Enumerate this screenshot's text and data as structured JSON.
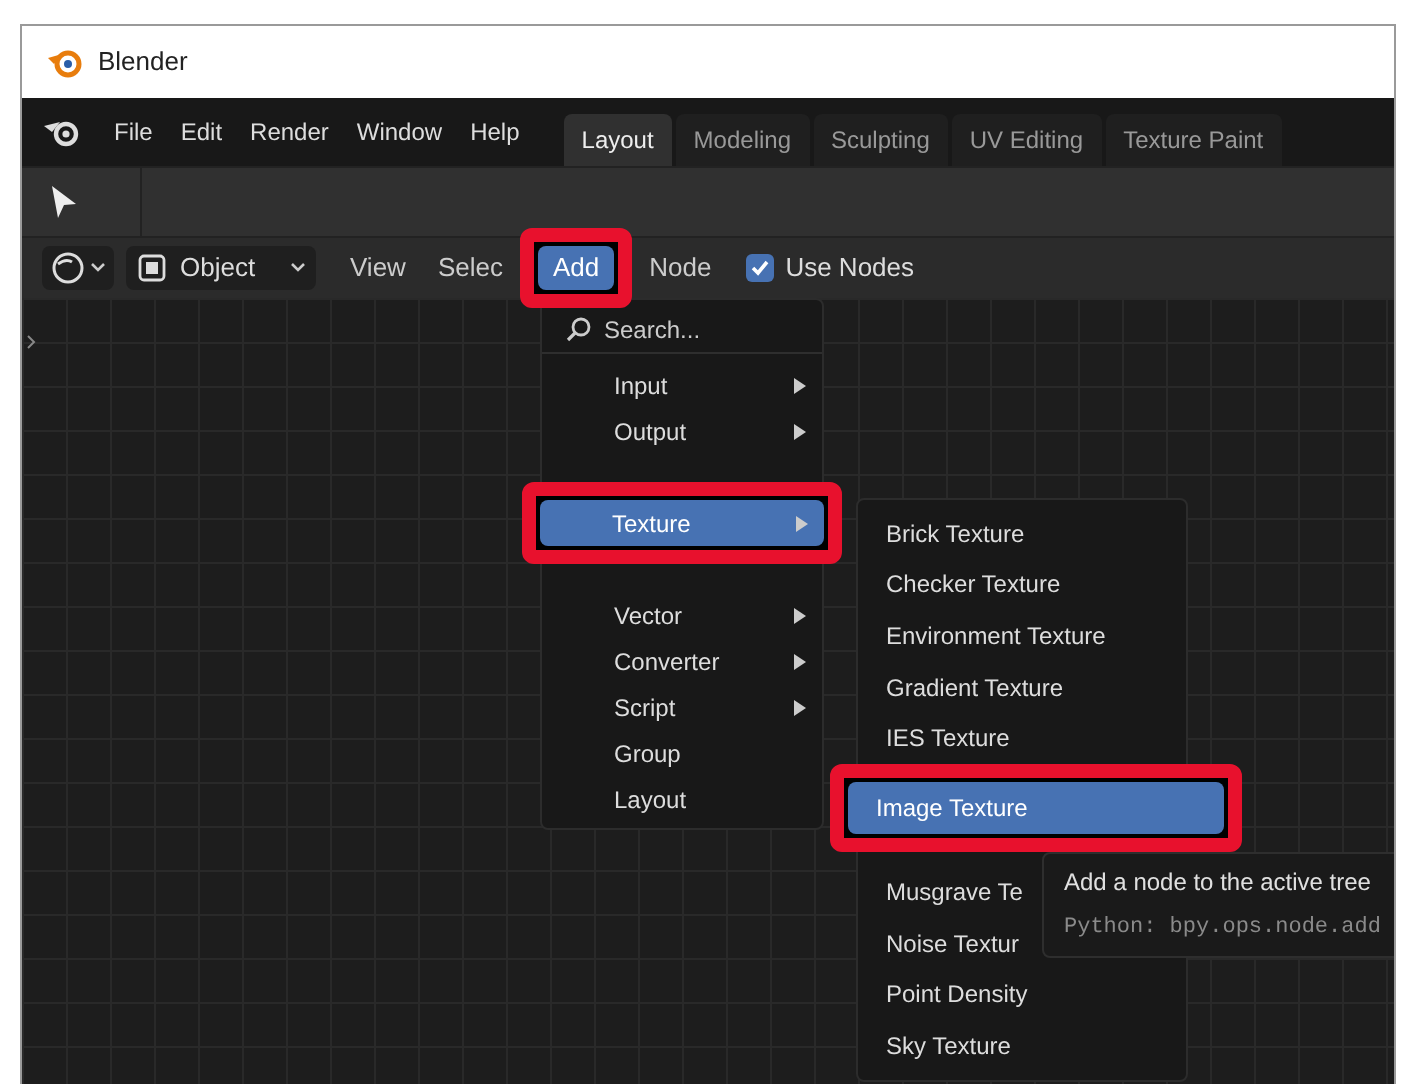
{
  "window": {
    "title": "Blender"
  },
  "menubar": {
    "items": [
      "File",
      "Edit",
      "Render",
      "Window",
      "Help"
    ]
  },
  "workspace_tabs": [
    {
      "label": "Layout",
      "selected": true
    },
    {
      "label": "Modeling",
      "selected": false
    },
    {
      "label": "Sculpting",
      "selected": false
    },
    {
      "label": "UV Editing",
      "selected": false
    },
    {
      "label": "Texture Paint",
      "selected": false
    }
  ],
  "header": {
    "mode": "Object",
    "menus": [
      {
        "label": "View",
        "selected": false,
        "highlighted": false
      },
      {
        "label": "Selec",
        "selected": false,
        "highlighted": false
      },
      {
        "label": "Add",
        "selected": true,
        "highlighted": true
      },
      {
        "label": "Node",
        "selected": false,
        "highlighted": false
      }
    ],
    "use_nodes": {
      "label": "Use Nodes",
      "checked": true
    }
  },
  "add_menu": {
    "search": "Search...",
    "items": [
      {
        "kind": "item",
        "label": "Input",
        "submenu": true,
        "selected": false,
        "highlighted": false
      },
      {
        "kind": "item",
        "label": "Output",
        "submenu": true,
        "selected": false,
        "highlighted": false
      },
      {
        "kind": "covered"
      },
      {
        "kind": "item",
        "label": "Texture",
        "submenu": true,
        "selected": true,
        "highlighted": true
      },
      {
        "kind": "covered"
      },
      {
        "kind": "item",
        "label": "Vector",
        "submenu": true,
        "selected": false,
        "highlighted": false
      },
      {
        "kind": "item",
        "label": "Converter",
        "submenu": true,
        "selected": false,
        "highlighted": false
      },
      {
        "kind": "item",
        "label": "Script",
        "submenu": true,
        "selected": false,
        "highlighted": false
      },
      {
        "kind": "item",
        "label": "Group",
        "submenu": false,
        "selected": false,
        "highlighted": false
      },
      {
        "kind": "item",
        "label": "Layout",
        "submenu": false,
        "selected": false,
        "highlighted": false
      }
    ]
  },
  "texture_menu": {
    "items": [
      {
        "kind": "item",
        "label": "Brick Texture",
        "selected": false,
        "highlighted": false
      },
      {
        "kind": "item",
        "label": "Checker Texture",
        "selected": false,
        "highlighted": false
      },
      {
        "kind": "item",
        "label": "Environment Texture",
        "selected": false,
        "highlighted": false
      },
      {
        "kind": "item",
        "label": "Gradient Texture",
        "selected": false,
        "highlighted": false
      },
      {
        "kind": "item",
        "label": "IES Texture",
        "selected": false,
        "highlighted": false
      },
      {
        "kind": "item",
        "label": "Image Texture",
        "selected": true,
        "highlighted": true
      },
      {
        "kind": "covered"
      },
      {
        "kind": "item",
        "label": "Musgrave Te",
        "selected": false,
        "highlighted": false
      },
      {
        "kind": "item",
        "label": "Noise Textur",
        "selected": false,
        "highlighted": false
      },
      {
        "kind": "item",
        "label": "Point Density",
        "selected": false,
        "highlighted": false
      },
      {
        "kind": "item",
        "label": "Sky Texture",
        "selected": false,
        "highlighted": false
      }
    ]
  },
  "tooltip": {
    "text": "Add a node to the active tree",
    "python": "Python: bpy.ops.node.add"
  }
}
